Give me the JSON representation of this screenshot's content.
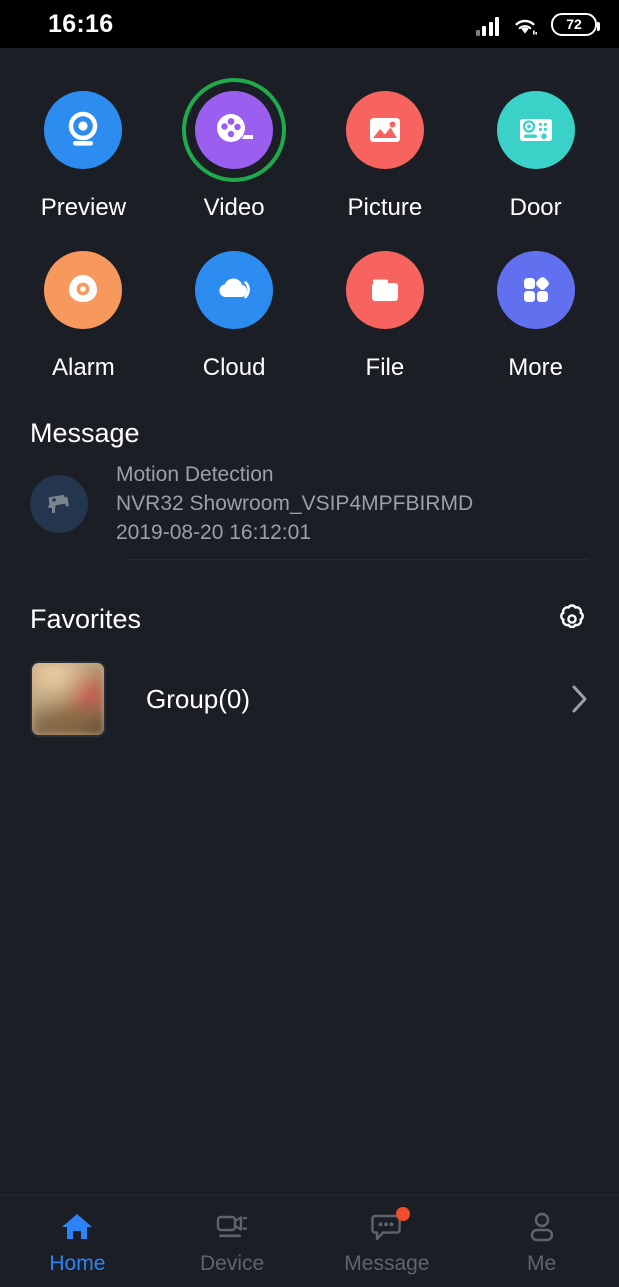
{
  "statusbar": {
    "time": "16:16",
    "battery_level": "72",
    "signal_icon": "signal-bars-icon",
    "wifi_icon": "wifi-icon",
    "battery_icon": "battery-icon"
  },
  "shortcuts": [
    {
      "label": "Preview",
      "icon": "webcam-icon",
      "color": "#2d8cf0",
      "selected": false
    },
    {
      "label": "Video",
      "icon": "film-reel-icon",
      "color": "#9b5ff0",
      "selected": true,
      "ring_color": "#1faa4b"
    },
    {
      "label": "Picture",
      "icon": "image-icon",
      "color": "#f7635f",
      "selected": false
    },
    {
      "label": "Door",
      "icon": "door-station-icon",
      "color": "#3ad1c8",
      "selected": false
    },
    {
      "label": "Alarm",
      "icon": "alarm-icon",
      "color": "#f7995c",
      "selected": false
    },
    {
      "label": "Cloud",
      "icon": "cloud-icon",
      "color": "#2d8cf0",
      "selected": false
    },
    {
      "label": "File",
      "icon": "folder-icon",
      "color": "#f7635f",
      "selected": false
    },
    {
      "label": "More",
      "icon": "grid-dots-icon",
      "color": "#6170ef",
      "selected": false
    }
  ],
  "message": {
    "title": "Message",
    "item": {
      "icon": "cctv-camera-icon",
      "event": "Motion Detection",
      "device": "NVR32 Showroom_VSIP4MPFBIRMD",
      "timestamp": "2019-08-20 16:12:01"
    }
  },
  "favorites": {
    "title": "Favorites",
    "settings_icon": "gear-icon",
    "item": {
      "name": "Group(0)",
      "thumbnail": "showroom-thumbnail",
      "chevron_icon": "chevron-right-icon"
    }
  },
  "bottom_nav": [
    {
      "label": "Home",
      "icon": "home-icon",
      "active": true,
      "badge": false
    },
    {
      "label": "Device",
      "icon": "device-icon",
      "active": false,
      "badge": false
    },
    {
      "label": "Message",
      "icon": "message-icon",
      "active": false,
      "badge": true
    },
    {
      "label": "Me",
      "icon": "person-icon",
      "active": false,
      "badge": false
    }
  ],
  "colors": {
    "background": "#1b1f25",
    "statusbar_background": "#000000",
    "accent": "#2d84f7",
    "selection_ring": "#1faa4b",
    "badge": "#f04b2a",
    "muted_text": "#9aa0a6"
  }
}
